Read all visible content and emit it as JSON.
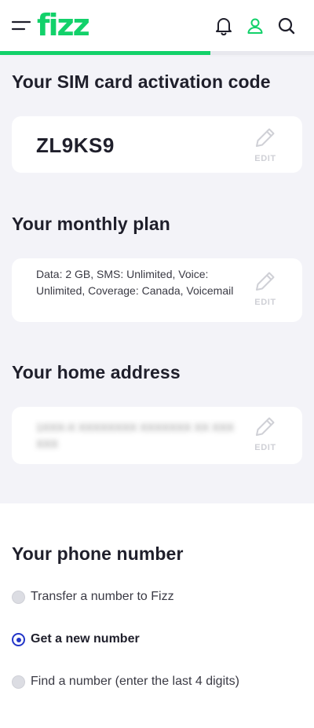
{
  "header": {
    "logo_text": "fizz",
    "icons": [
      "menu-icon",
      "bell-icon",
      "user-icon",
      "search-icon"
    ],
    "progress_fraction": 0.67,
    "colors": {
      "brand_green": "#12d16a",
      "radio_blue": "#2336c8",
      "text_dark": "#1f1f2b",
      "panel_bg": "#f3f3f8"
    }
  },
  "sim": {
    "title": "Your SIM card activation code",
    "code": "ZL9KS9",
    "edit_label": "EDIT"
  },
  "plan": {
    "title": "Your monthly plan",
    "details": "Data: 2 GB, SMS: Unlimited, Voice: Unlimited, Coverage: Canada, Voicemail",
    "edit_label": "EDIT"
  },
  "address": {
    "title": "Your home address",
    "value": "1XXX-X XXXXXXXX XXXXXXX XX XXX XXX",
    "edit_label": "EDIT"
  },
  "phone": {
    "title": "Your phone number",
    "options": [
      {
        "label": "Transfer a number to Fizz",
        "selected": false
      },
      {
        "label": "Get a new number",
        "selected": true
      },
      {
        "label": "Find a number (enter the last 4 digits)",
        "selected": false
      }
    ]
  }
}
